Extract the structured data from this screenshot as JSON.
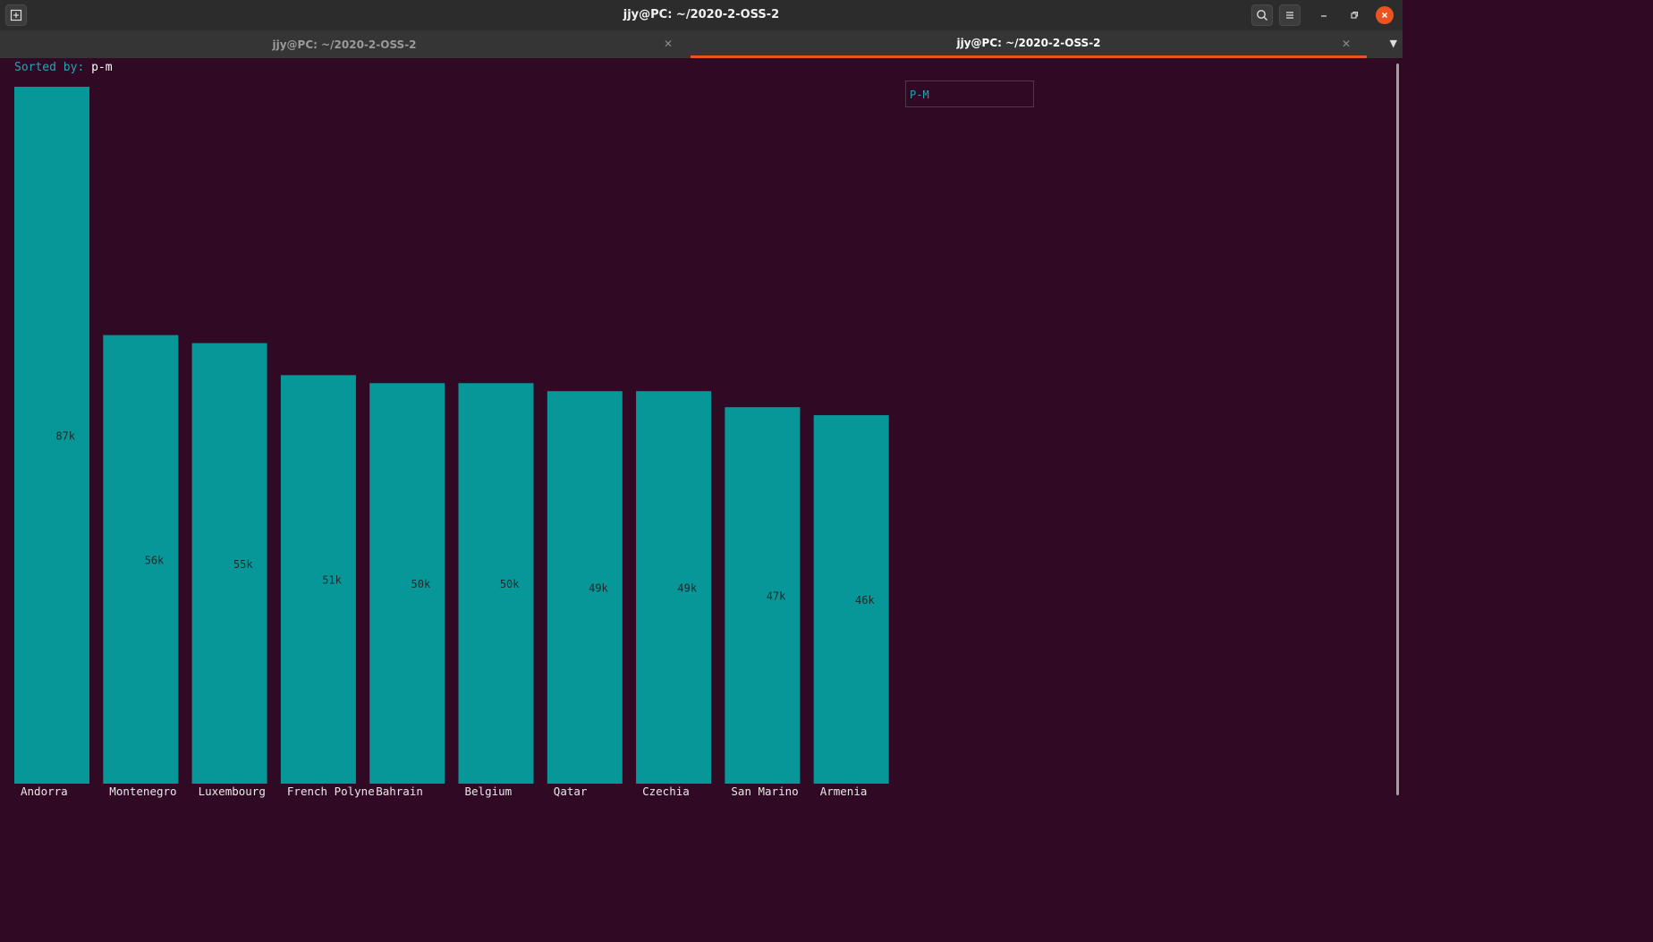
{
  "window": {
    "title": "jjy@PC: ~/2020-2-OSS-2",
    "new_tab_icon": "new-tab-icon",
    "search_icon": "search-icon",
    "menu_icon": "hamburger-menu-icon",
    "minimize_icon": "minimize-icon",
    "restore_icon": "restore-icon",
    "close_icon": "close-icon"
  },
  "tabs": [
    {
      "label": "jjy@PC: ~/2020-2-OSS-2",
      "active": false
    },
    {
      "label": "jjy@PC: ~/2020-2-OSS-2",
      "active": true
    }
  ],
  "terminal": {
    "sorted_label": "Sorted by:",
    "sorted_value": "p-m",
    "legend": "P-M"
  },
  "colors": {
    "background": "#300a24",
    "bar": "#089799",
    "accent": "#e95420",
    "label": "#2aa1b3"
  },
  "chart_data": {
    "type": "bar",
    "categories": [
      "Andorra",
      "Montenegro",
      "Luxembourg",
      "French Polyne",
      "Bahrain",
      "Belgium",
      "Qatar",
      "Czechia",
      "San Marino",
      "Armenia"
    ],
    "values": [
      87,
      56,
      55,
      51,
      50,
      50,
      49,
      49,
      47,
      46
    ],
    "value_labels": [
      "87k",
      "56k",
      "55k",
      "51k",
      "50k",
      "50k",
      "49k",
      "49k",
      "47k",
      "46k"
    ],
    "series": [
      {
        "name": "P-M",
        "values": [
          87,
          56,
          55,
          51,
          50,
          50,
          49,
          49,
          47,
          46
        ]
      }
    ],
    "ylim": [
      0,
      87
    ],
    "legend_position": "top-right",
    "grid": false
  }
}
